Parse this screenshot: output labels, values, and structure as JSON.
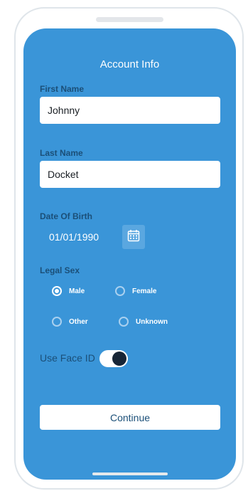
{
  "screen": {
    "title": "Account Info"
  },
  "first_name": {
    "label": "First Name",
    "value": "Johnny"
  },
  "last_name": {
    "label": "Last Name",
    "value": "Docket"
  },
  "dob": {
    "label": "Date Of Birth",
    "value": "01/01/1990",
    "icon": "calendar-icon"
  },
  "legal_sex": {
    "label": "Legal Sex",
    "selected": "Male",
    "options": [
      "Male",
      "Female",
      "Other",
      "Unknown"
    ]
  },
  "face_id": {
    "label": "Use Face ID",
    "enabled": true
  },
  "continue_label": "Continue",
  "colors": {
    "background": "#3a95d8",
    "label": "#1b4f78",
    "toggle_knob": "#172536"
  }
}
